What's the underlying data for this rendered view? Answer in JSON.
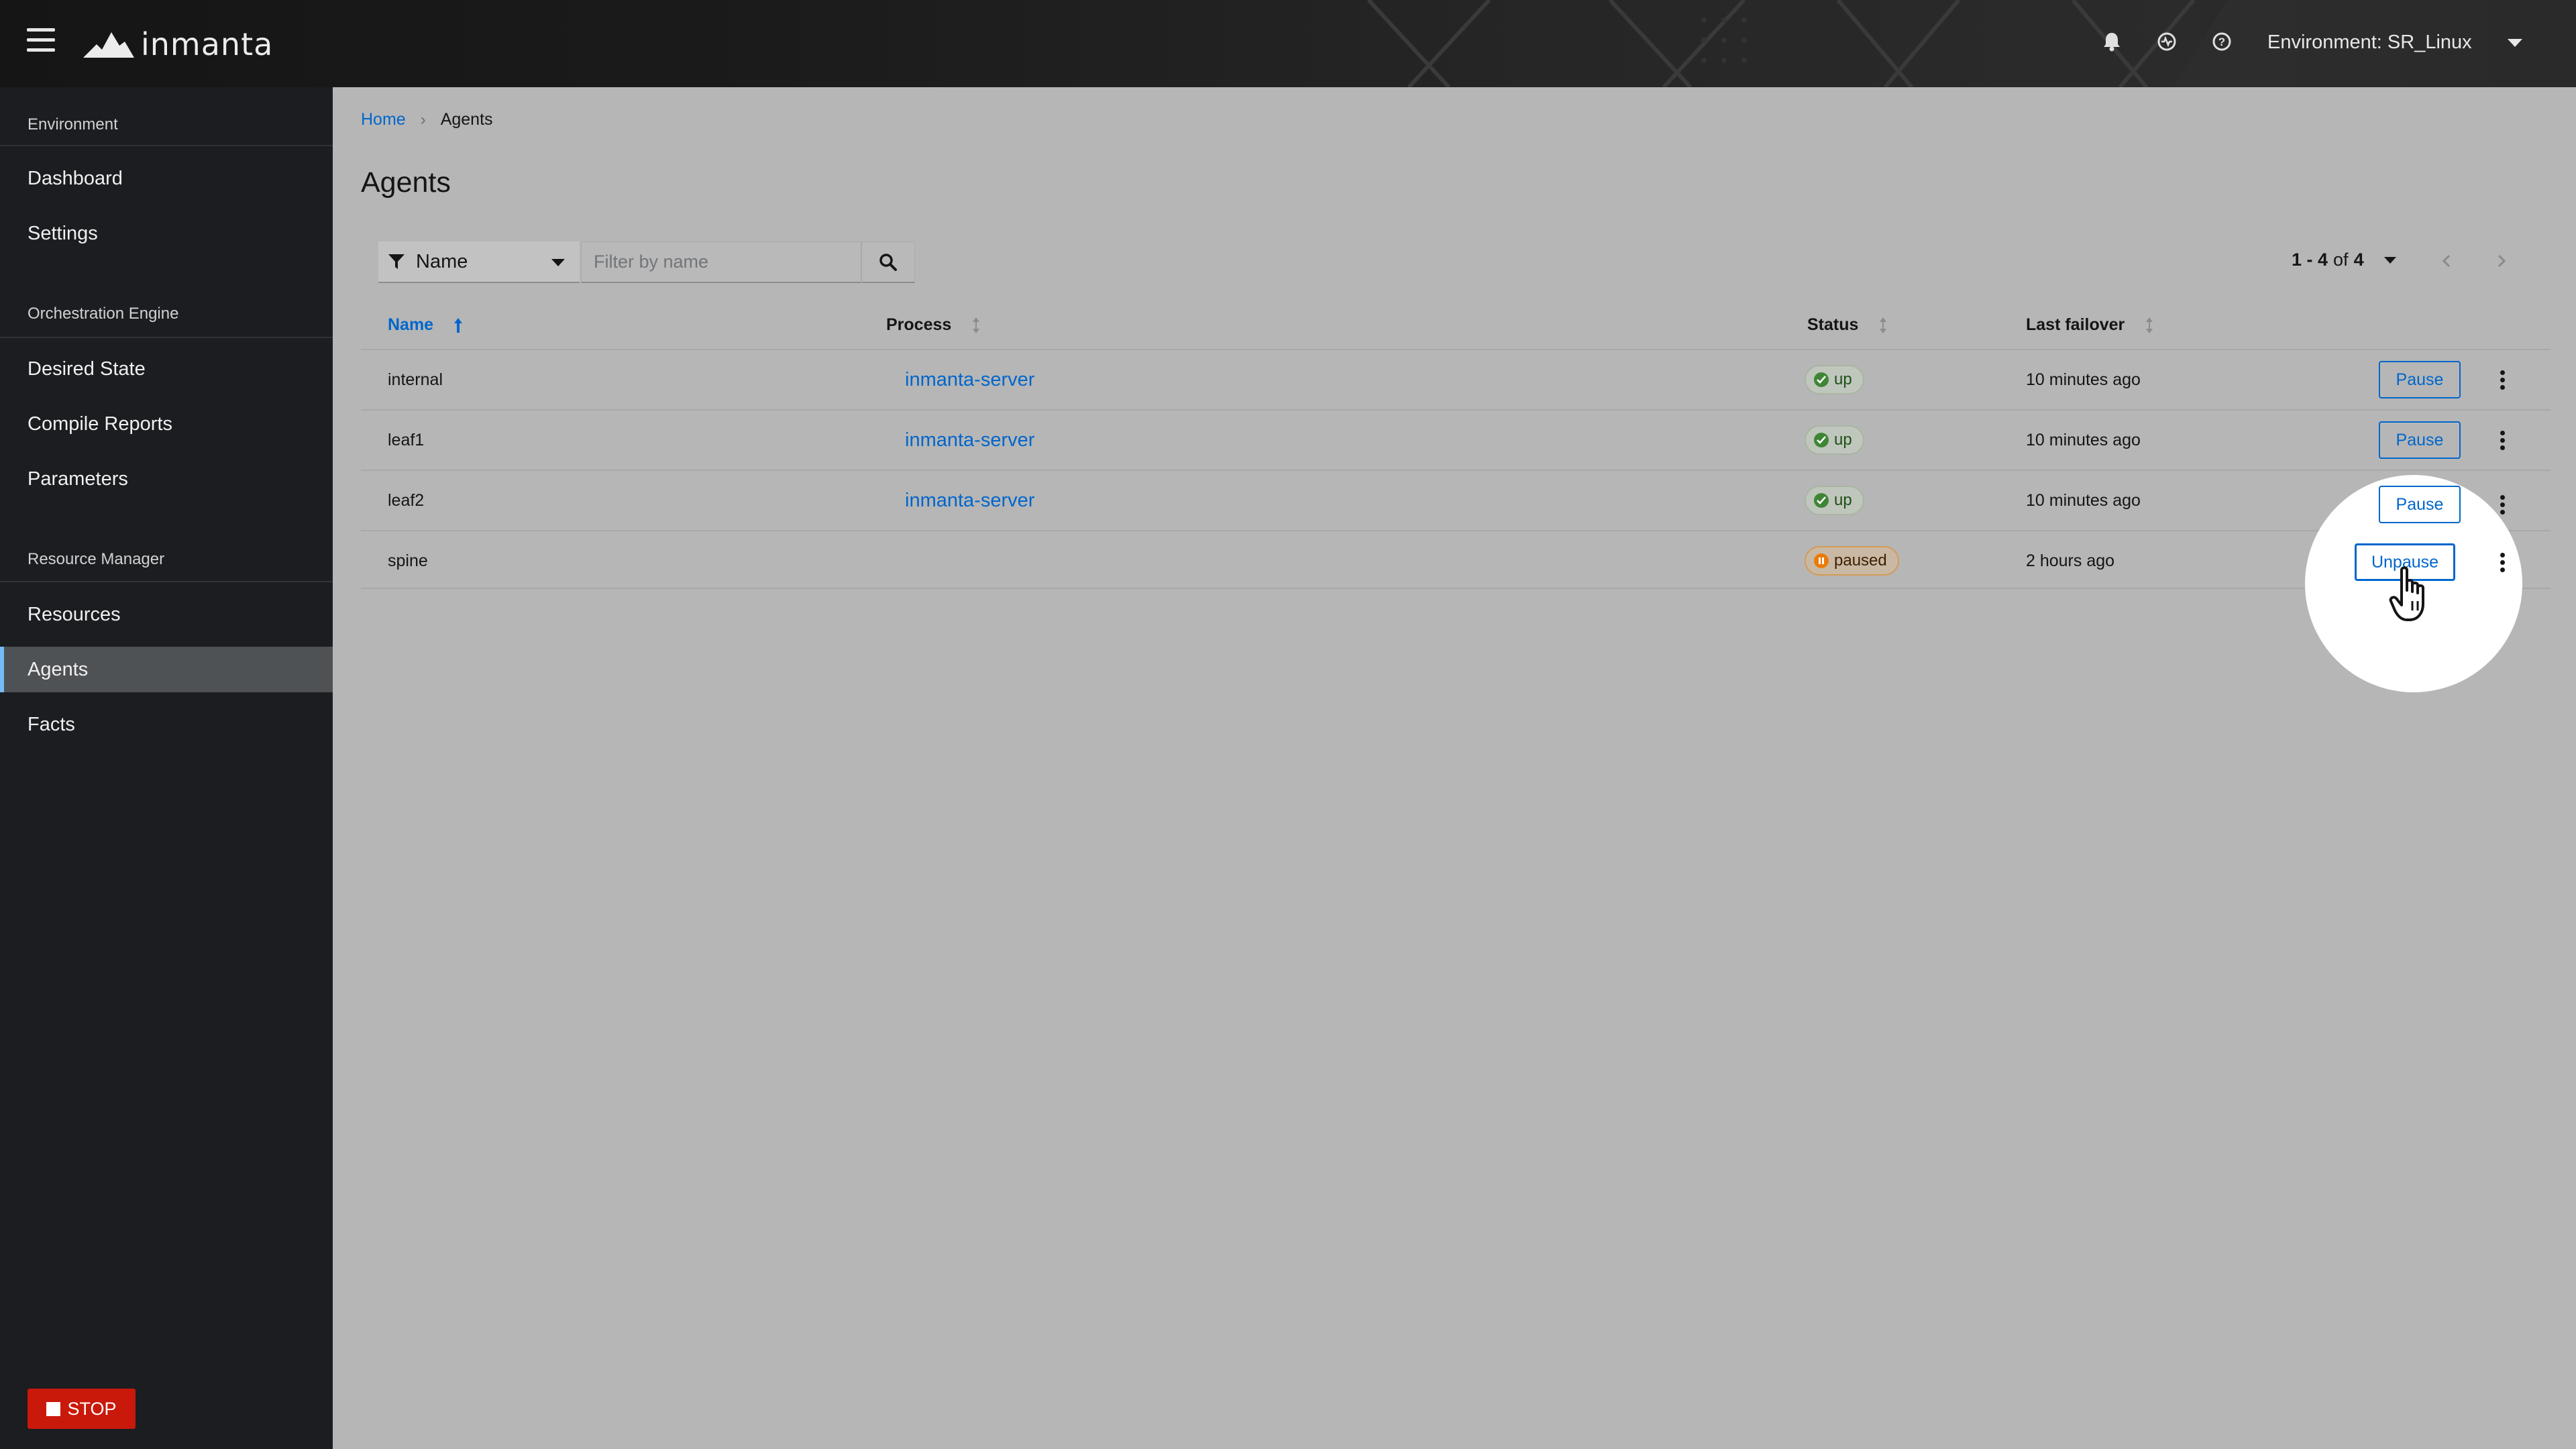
{
  "header": {
    "logo_text": "inmanta",
    "env_label": "Environment: SR_Linux",
    "icons": [
      "bell-icon",
      "status-icon",
      "help-icon"
    ]
  },
  "sidebar": {
    "sections": [
      {
        "title": "Environment",
        "items": [
          "Dashboard",
          "Settings"
        ]
      },
      {
        "title": "Orchestration Engine",
        "items": [
          "Desired State",
          "Compile Reports",
          "Parameters"
        ]
      },
      {
        "title": "Resource Manager",
        "items": [
          "Resources",
          "Agents",
          "Facts"
        ]
      }
    ],
    "active_item": "Agents",
    "stop_label": "STOP"
  },
  "breadcrumb": {
    "home": "Home",
    "current": "Agents"
  },
  "page_title": "Agents",
  "toolbar": {
    "filter_label": "Name",
    "search_placeholder": "Filter by name",
    "pager_range": "1 - 4",
    "pager_of": "of",
    "pager_total": "4"
  },
  "table": {
    "columns": [
      "Name",
      "Process",
      "Status",
      "Last failover"
    ],
    "sorted_column": "Name",
    "rows": [
      {
        "name": "internal",
        "process": "inmanta-server",
        "status": "up",
        "last_failover": "10 minutes ago",
        "action": "Pause"
      },
      {
        "name": "leaf1",
        "process": "inmanta-server",
        "status": "up",
        "last_failover": "10 minutes ago",
        "action": "Pause"
      },
      {
        "name": "leaf2",
        "process": "inmanta-server",
        "status": "up",
        "last_failover": "10 minutes ago",
        "action": "Pause"
      },
      {
        "name": "spine",
        "process": "",
        "status": "paused",
        "last_failover": "2 hours ago",
        "action": "Unpause"
      }
    ]
  },
  "colors": {
    "link": "#0066cc",
    "stop": "#c9190b",
    "status_up": "#3e8635",
    "status_paused": "#ec7a08"
  }
}
